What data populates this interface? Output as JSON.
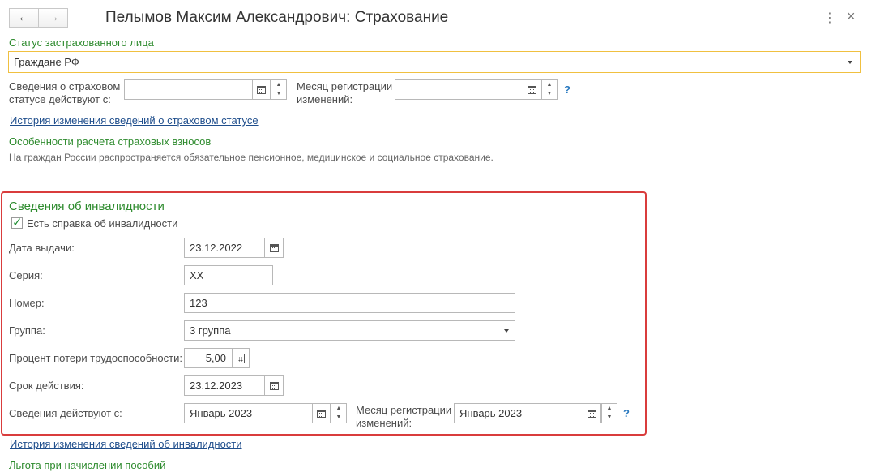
{
  "window": {
    "title": "Пелымов Максим Александрович: Страхование",
    "back_icon": "←",
    "forward_icon": "→",
    "menu_icon": "⋮",
    "close_icon": "×"
  },
  "insured_status": {
    "label": "Статус застрахованного лица",
    "value": "Граждане РФ"
  },
  "status_dates": {
    "effective_label_line1": "Сведения о страховом",
    "effective_label_line2": "статусе действуют с:",
    "effective_value": "",
    "month_label_line1": "Месяц регистрации",
    "month_label_line2": "изменений:",
    "month_value": "",
    "help": "?"
  },
  "status_history_link": "История изменения сведений о страховом статусе",
  "contributions": {
    "heading": "Особенности расчета страховых взносов",
    "text": "На граждан России распространяется обязательное пенсионное, медицинское и социальное страхование."
  },
  "disability": {
    "heading": "Сведения об инвалидности",
    "has_certificate_label": "Есть справка об инвалидности",
    "has_certificate_checked": true,
    "issue_date_label": "Дата выдачи:",
    "issue_date_value": "23.12.2022",
    "series_label": "Серия:",
    "series_value": "ХХ",
    "number_label": "Номер:",
    "number_value": "123",
    "group_label": "Группа:",
    "group_value": "3 группа",
    "percent_label": "Процент потери трудоспособности:",
    "percent_value": "5,00",
    "validity_label": "Срок действия:",
    "validity_value": "23.12.2023",
    "effective_label": "Сведения действуют с:",
    "effective_value": "Январь 2023",
    "month_label_line1": "Месяц регистрации",
    "month_label_line2": "изменений:",
    "month_value": "Январь 2023",
    "help": "?"
  },
  "disability_history_link": "История изменения сведений об инвалидности",
  "benefits_heading": "Льгота при начислении пособий",
  "colors": {
    "accent_green": "#2e8b2e",
    "link_blue": "#1f4e8c",
    "highlight_red": "#d93c3c",
    "focus_yellow": "#f0c040"
  }
}
